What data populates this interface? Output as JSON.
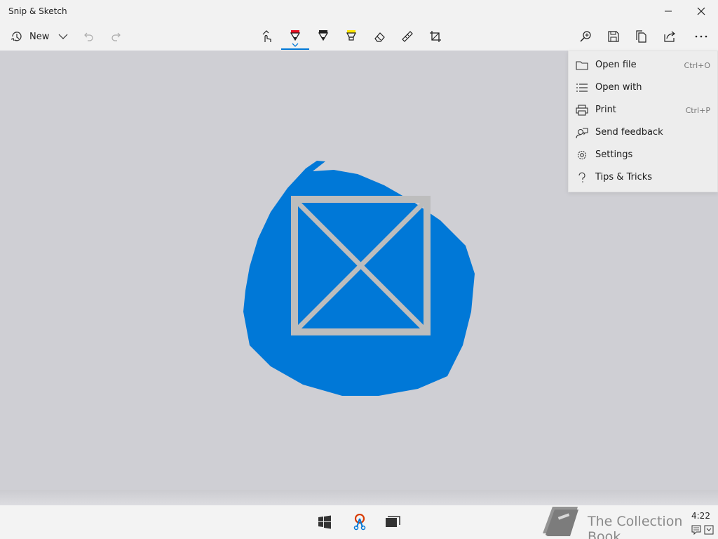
{
  "app": {
    "title": "Snip & Sketch"
  },
  "toolbar": {
    "new_label": "New",
    "tools": [
      {
        "name": "touch-writing",
        "icon": "touch-writing-icon"
      },
      {
        "name": "ballpoint-pen",
        "icon": "ballpoint-pen-icon",
        "selected": true
      },
      {
        "name": "pencil",
        "icon": "pencil-icon"
      },
      {
        "name": "highlighter",
        "icon": "highlighter-icon"
      },
      {
        "name": "eraser",
        "icon": "eraser-icon"
      },
      {
        "name": "ruler",
        "icon": "ruler-icon"
      },
      {
        "name": "image-crop",
        "icon": "crop-icon"
      }
    ],
    "right_actions": [
      "zoom-icon",
      "save-icon",
      "copy-icon",
      "share-icon",
      "more-icon"
    ]
  },
  "menu": {
    "items": [
      {
        "label": "Open file",
        "shortcut": "Ctrl+O",
        "icon": "folder-icon"
      },
      {
        "label": "Open with",
        "shortcut": "",
        "icon": "list-icon"
      },
      {
        "label": "Print",
        "shortcut": "Ctrl+P",
        "icon": "printer-icon"
      },
      {
        "label": "Send feedback",
        "shortcut": "",
        "icon": "feedback-icon"
      },
      {
        "label": "Settings",
        "shortcut": "",
        "icon": "gear-icon"
      },
      {
        "label": "Tips & Tricks",
        "shortcut": "",
        "icon": "question-icon"
      }
    ]
  },
  "colors": {
    "accent": "#0078d7",
    "pen_red": "#e81123",
    "highlighter_yellow": "#ffe600",
    "canvas": "#cfcfd4",
    "placeholder_gray": "#bdbdbd"
  },
  "taskbar": {
    "icons": [
      "windows-start-icon",
      "snip-sketch-app-icon",
      "task-view-icon"
    ],
    "clock": "4:22"
  },
  "watermark": {
    "text": "The Collection Book"
  }
}
